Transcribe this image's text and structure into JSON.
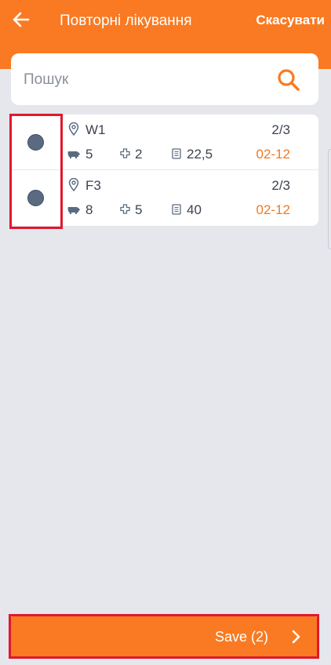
{
  "header": {
    "title": "Повторні лікування",
    "cancel_label": "Скасувати",
    "back_icon": "arrow-left-icon"
  },
  "search": {
    "placeholder": "Пошук",
    "value": "",
    "icon": "search-icon"
  },
  "items": [
    {
      "location": "W1",
      "fraction": "2/3",
      "pigs": "5",
      "treatments": "2",
      "dose": "22,5",
      "date": "02-12",
      "selected": true
    },
    {
      "location": "F3",
      "fraction": "2/3",
      "pigs": "8",
      "treatments": "5",
      "dose": "40",
      "date": "02-12",
      "selected": true
    }
  ],
  "footer": {
    "save_label": "Save (2)",
    "chevron_icon": "chevron-right-icon"
  },
  "colors": {
    "accent": "#f97a22",
    "radio": "#5a6b81",
    "date": "#f07a22",
    "highlight": "#e0182d",
    "background": "#e5e7ec"
  }
}
